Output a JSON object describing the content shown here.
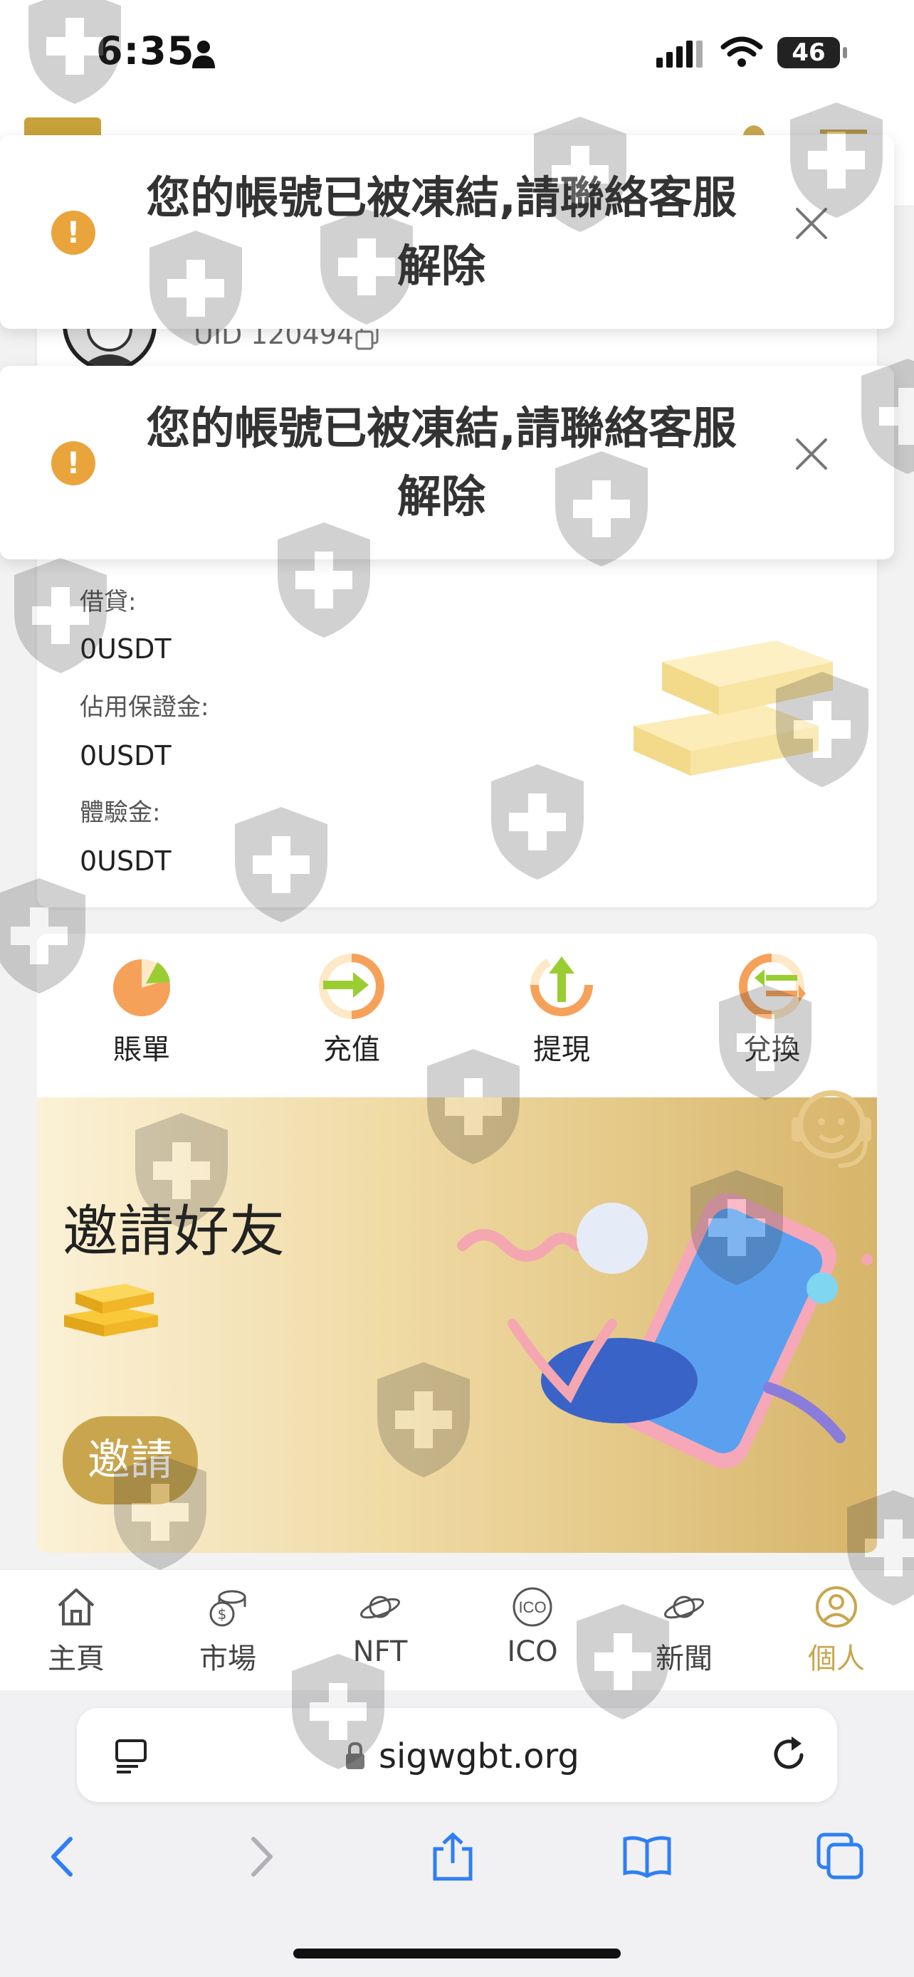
{
  "status_bar": {
    "time": "6:35",
    "battery": "46"
  },
  "toasts": [
    {
      "message": "您的帳號已被凍結,請聯絡客服解除"
    },
    {
      "message": "您的帳號已被凍結,請聯絡客服解除"
    }
  ],
  "account": {
    "uid_label": "UID",
    "uid_value": "120494",
    "balances": [
      {
        "label": "借貸:",
        "value": "0USDT"
      },
      {
        "label": "佔用保證金:",
        "value": "0USDT"
      },
      {
        "label": "體驗金:",
        "value": "0USDT"
      }
    ]
  },
  "actions": [
    {
      "label": "賬單",
      "icon": "bill-pie-icon"
    },
    {
      "label": "充值",
      "icon": "deposit-arrow-icon"
    },
    {
      "label": "提現",
      "icon": "withdraw-arrow-icon"
    },
    {
      "label": "兌換",
      "icon": "exchange-arrows-icon"
    }
  ],
  "invite": {
    "title": "邀請好友",
    "button": "邀請"
  },
  "bottom_nav": [
    {
      "label": "主頁",
      "icon": "home-icon",
      "active": false
    },
    {
      "label": "市場",
      "icon": "coins-icon",
      "active": false
    },
    {
      "label": "NFT",
      "icon": "planet-icon",
      "active": false
    },
    {
      "label": "ICO",
      "icon": "ico-icon",
      "active": false
    },
    {
      "label": "新聞",
      "icon": "planet-icon",
      "active": false
    },
    {
      "label": "個人",
      "icon": "person-circle-icon",
      "active": true
    }
  ],
  "browser": {
    "url": "sigwgbt.org"
  },
  "colors": {
    "accent": "#c9a64e",
    "warning": "#e9a43c",
    "orange": "#f6a15a",
    "green": "#9acd32"
  }
}
